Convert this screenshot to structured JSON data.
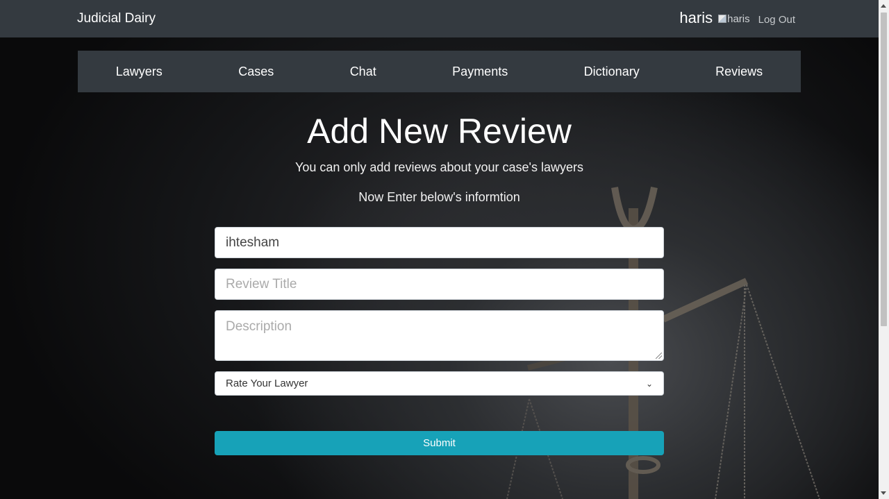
{
  "header": {
    "brand": "Judicial Dairy",
    "username": "haris",
    "avatar_alt": "haris",
    "logout": "Log Out"
  },
  "nav": {
    "items": [
      "Lawyers",
      "Cases",
      "Chat",
      "Payments",
      "Dictionary",
      "Reviews"
    ]
  },
  "main": {
    "title": "Add New Review",
    "subtitle": "You can only add reviews about your case's lawyers",
    "instruction": "Now Enter below's informtion"
  },
  "form": {
    "lawyer_value": "ihtesham",
    "title_placeholder": "Review Title",
    "description_placeholder": "Description",
    "rating_selected": "Rate Your Lawyer",
    "submit_label": "Submit"
  },
  "colors": {
    "topbar": "#343a40",
    "submit": "#17a2b8"
  }
}
